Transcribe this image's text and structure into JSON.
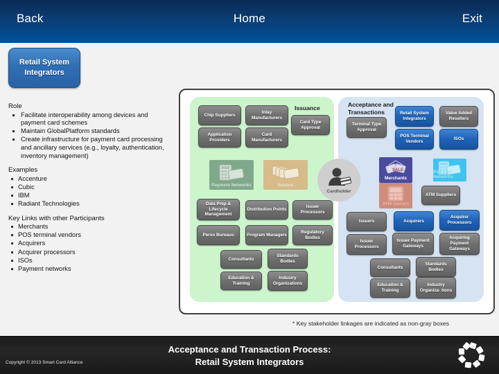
{
  "header": {
    "back_label": "Back",
    "home_label": "Home",
    "exit_label": "Exit"
  },
  "title_pill": {
    "label": "Retail System Integrators"
  },
  "info_panel": {
    "role_heading": "Role",
    "role_items": [
      "Facilitate interoperability among devices and payment card schemes",
      "Maintain GlobalPlatform standards",
      "Create infrastructure for payment card processing and ancillary services (e.g., loyalty, authentication, inventory management)"
    ],
    "examples_heading": "Examples",
    "examples_items": [
      "Accenture",
      "Cubic",
      "IBM",
      "Radiant Technologies"
    ],
    "links_heading": "Key Links with other Participants",
    "links_items": [
      "Merchants",
      "POS terminal vendors",
      "Acquirers",
      "Acquirer processors",
      "ISOs",
      "Payment networks"
    ]
  },
  "diagram": {
    "issuance_title": "Issuance",
    "acceptance_title": "Acceptance and Transactions",
    "cardholder_label": "Cardholder",
    "issuance_nodes": [
      {
        "label": "Chip Suppliers",
        "style": "gray"
      },
      {
        "label": "Inlay Manufacturers",
        "style": "gray"
      },
      {
        "label": "Application Providers",
        "style": "gray"
      },
      {
        "label": "Card Manufacturers",
        "style": "gray"
      },
      {
        "label": "Card Type Approval",
        "style": "gray"
      },
      {
        "label": "Data Prep & Lifecycle Management",
        "style": "gray"
      },
      {
        "label": "Distribution Points",
        "style": "gray"
      },
      {
        "label": "Issuer Processors",
        "style": "gray"
      },
      {
        "label": "Perso Bureaus",
        "style": "gray"
      },
      {
        "label": "Program Managers",
        "style": "gray"
      },
      {
        "label": "Regulatory Bodies",
        "style": "gray"
      },
      {
        "label": "Consultants",
        "style": "gray"
      },
      {
        "label": "Standards Bodies",
        "style": "gray"
      },
      {
        "label": "Education & Training",
        "style": "gray"
      },
      {
        "label": "Industry Organizations",
        "style": "gray"
      }
    ],
    "acceptance_nodes": [
      {
        "label": "Terminal Type Approval",
        "style": "gray"
      },
      {
        "label": "Retail System Integrators",
        "style": "blue"
      },
      {
        "label": "Value Added Resellers",
        "style": "gray"
      },
      {
        "label": "POS Terminal Vendors",
        "style": "blue"
      },
      {
        "label": "ISOs",
        "style": "blue"
      },
      {
        "label": "ATM Suppliers",
        "style": "gray"
      },
      {
        "label": "Issuers",
        "style": "gray"
      },
      {
        "label": "Acquirers",
        "style": "blue"
      },
      {
        "label": "Acquirer Processors",
        "style": "blue"
      },
      {
        "label": "Issuer Processors",
        "style": "gray"
      },
      {
        "label": "Issuer Payment Gateways",
        "style": "gray"
      },
      {
        "label": "Acquiring Payment Gateways",
        "style": "gray"
      },
      {
        "label": "Consultants",
        "style": "gray"
      },
      {
        "label": "Standards Bodies",
        "style": "gray"
      },
      {
        "label": "Education & Training",
        "style": "gray"
      },
      {
        "label": "Industry Organiza- tions",
        "style": "gray"
      }
    ],
    "tiles": [
      {
        "label": "Payment Networks",
        "icon": "terminal-card-icon"
      },
      {
        "label": "Issuers",
        "icon": "card-stack-icon"
      },
      {
        "label": "Merchants",
        "icon": "sale-tags-icon"
      },
      {
        "label": "ATM Owners",
        "icon": "atm-machine-icon"
      },
      {
        "label": "Payment Networks",
        "icon": "terminal-card-icon"
      }
    ]
  },
  "footnote": "* Key stakeholder linkages are indicated as non-gray boxes",
  "footer": {
    "copyright": "Copyright © 2013 Smart Card Alliance",
    "title_line1": "Acceptance and Transaction Process:",
    "title_line2": "Retail System Integrators"
  },
  "colors": {
    "header_blue": "#00529c",
    "highlight_blue": "#1f63b8",
    "node_gray": "#707070",
    "issuance_zone": "#ccf5cc",
    "acceptance_zone": "#d5e3f2"
  }
}
